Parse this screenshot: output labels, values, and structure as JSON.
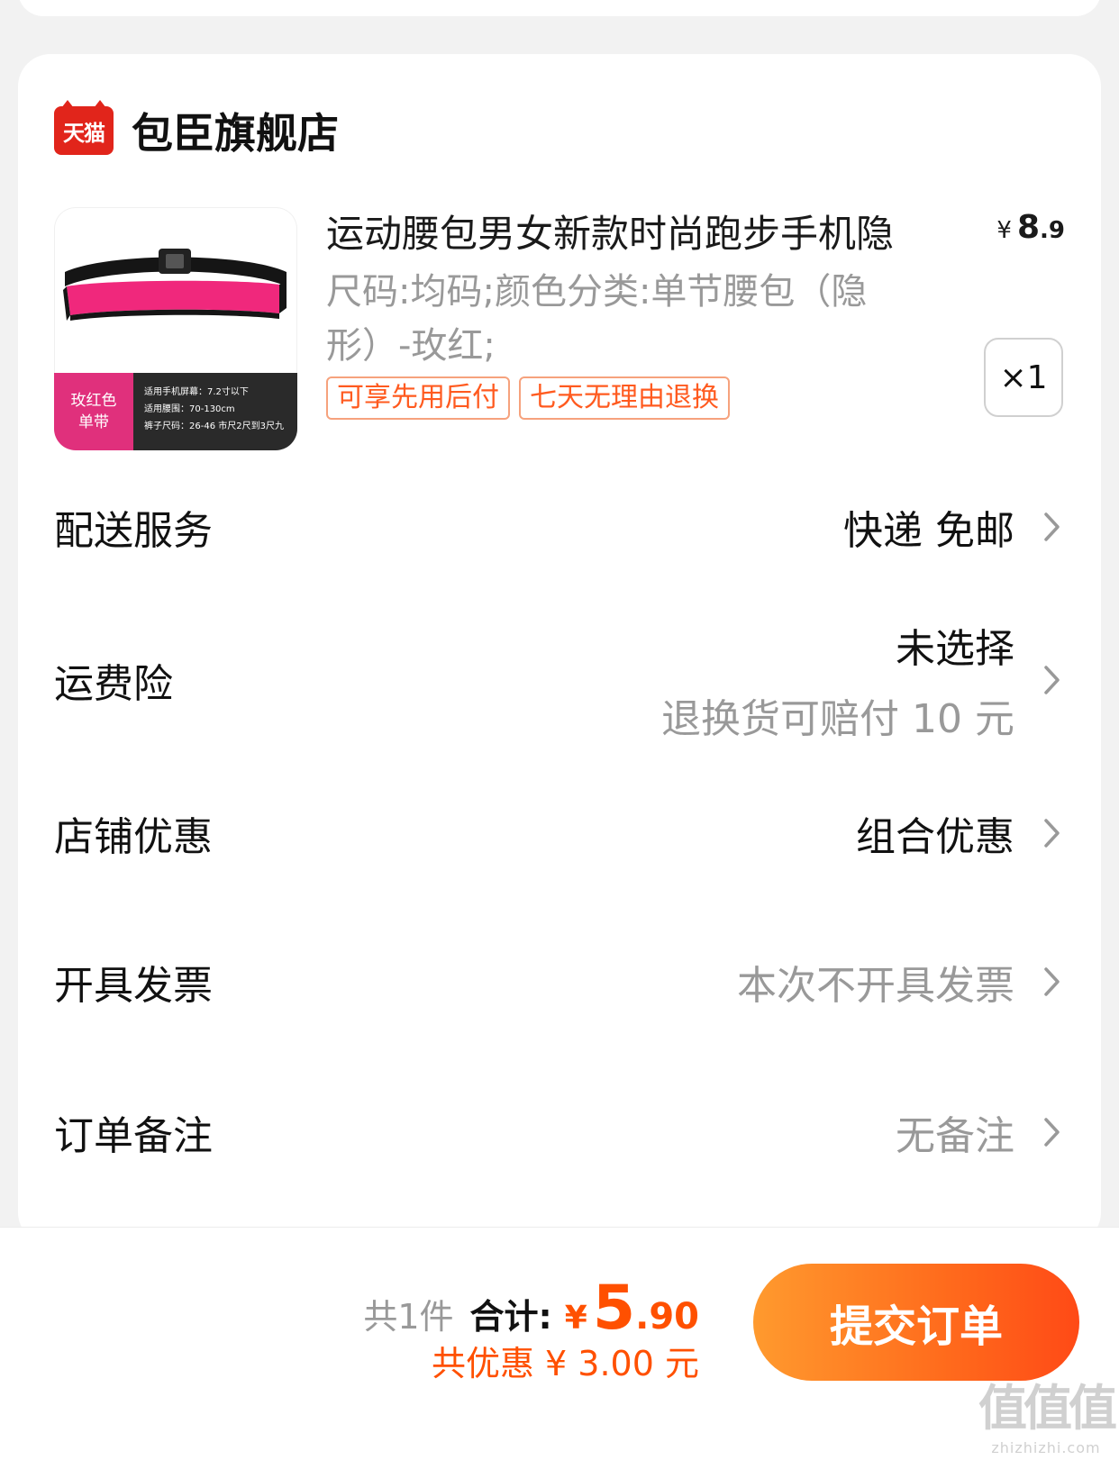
{
  "shop": {
    "badge": "天猫",
    "name": "包臣旗舰店"
  },
  "product": {
    "image_label_line1": "玫红色",
    "image_label_line2": "单带",
    "image_spec_line1": "适用手机屏幕：7.2寸以下",
    "image_spec_line2": "适用腰围：70-130cm",
    "image_spec_line3": "裤子尺码：26-46 市尺2尺到3尺九",
    "title": "运动腰包男女新款时尚跑步手机隐",
    "price_currency": "¥",
    "price_int": "8",
    "price_dec": ".9",
    "spec": "尺码:均码;颜色分类:单节腰包（隐形）-玫红;",
    "tags": [
      "可享先用后付",
      "七天无理由退换"
    ],
    "quantity": "×1"
  },
  "rows": {
    "delivery": {
      "label": "配送服务",
      "value": "快递 免邮"
    },
    "shipping_insurance": {
      "label": "运费险",
      "value": "未选择",
      "sub": "退换货可赔付 10 元"
    },
    "shop_discount": {
      "label": "店铺优惠",
      "value": "组合优惠"
    },
    "invoice": {
      "label": "开具发票",
      "value": "本次不开具发票"
    },
    "remark": {
      "label": "订单备注",
      "value": "无备注"
    }
  },
  "footer": {
    "count": "共1件",
    "total_label": "合计:",
    "total_currency": "¥",
    "total_int": "5",
    "total_dec": ".90",
    "discount": "共优惠 ¥ 3.00 元",
    "submit": "提交订单"
  },
  "watermark": {
    "big": "值值值",
    "small": "zhizhizhi.com"
  },
  "colors": {
    "accent": "#ff5000",
    "tmall_red": "#e1251b",
    "tag_border": "#f6a27d"
  }
}
